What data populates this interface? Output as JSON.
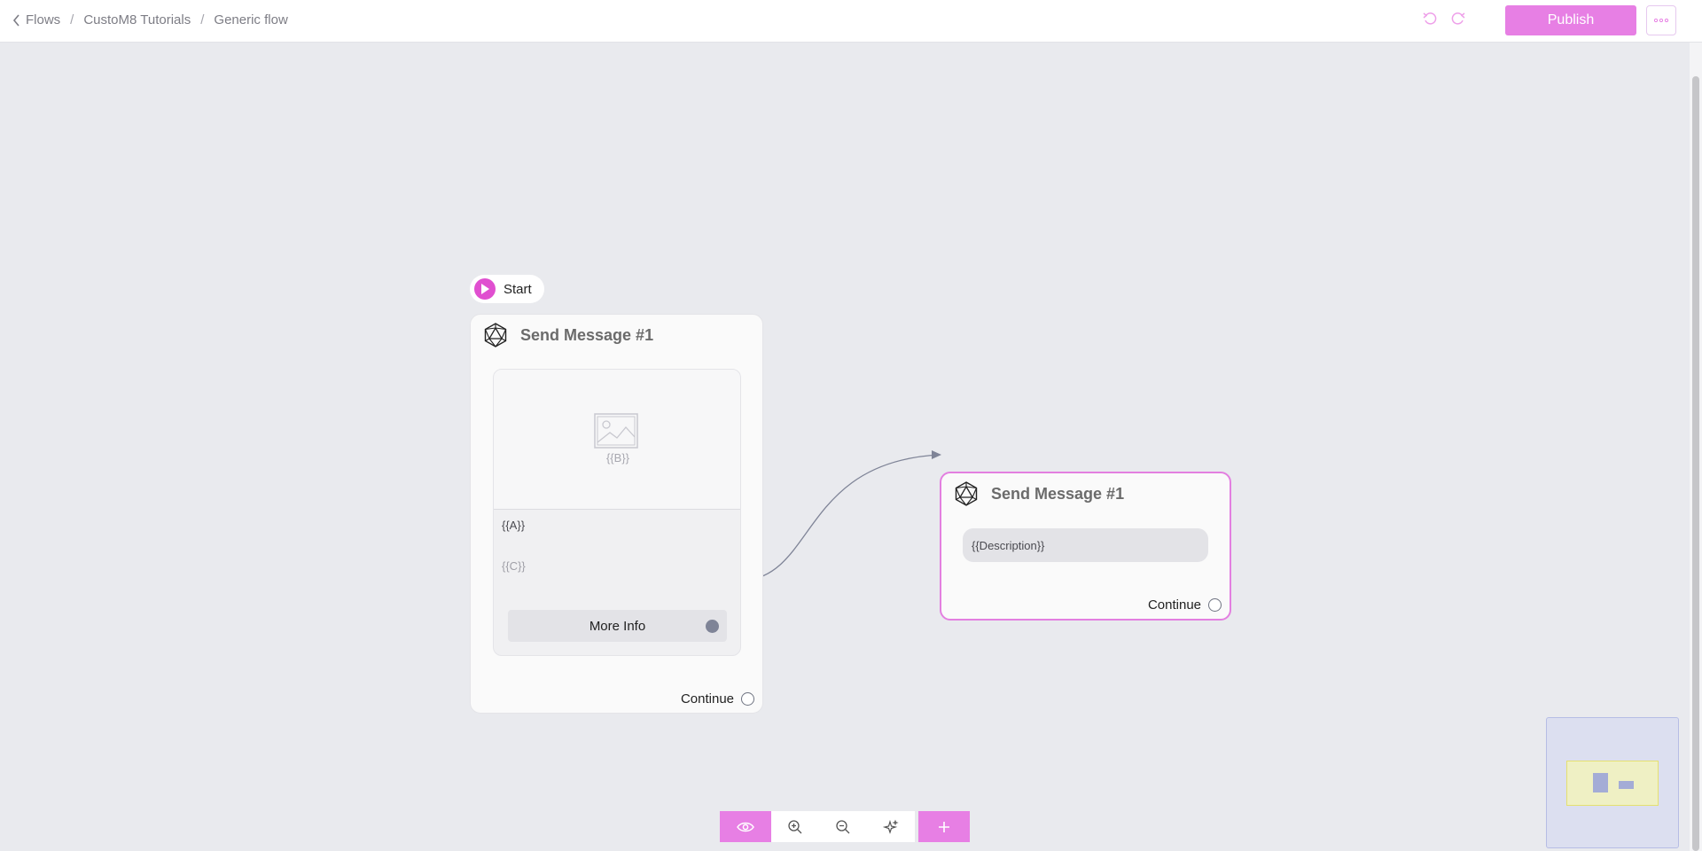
{
  "breadcrumb": {
    "items": [
      "Flows",
      "CustoM8 Tutorials",
      "Generic flow"
    ],
    "separator": "/"
  },
  "header": {
    "publish_label": "Publish",
    "undo_icon": "undo-icon",
    "redo_icon": "redo-icon",
    "more_icon": "more-horizontal-icon"
  },
  "canvas": {
    "start_label": "Start",
    "nodes": [
      {
        "title": "Send Message #1",
        "image_placeholder": "{{B}}",
        "text_var_a": "{{A}}",
        "text_var_c": "{{C}}",
        "button_label": "More Info",
        "continue_label": "Continue"
      },
      {
        "title": "Send Message #1",
        "description": "{{Description}}",
        "continue_label": "Continue"
      }
    ]
  },
  "toolbar": {
    "items": [
      "eye-icon",
      "zoom-in-icon",
      "zoom-out-icon",
      "sparkle-icon",
      "plus-icon"
    ]
  },
  "colors": {
    "accent": "#e77fe4",
    "canvas_bg": "#e9eaee",
    "selected_border": "#e37fe0",
    "handle": "#7f8497"
  }
}
